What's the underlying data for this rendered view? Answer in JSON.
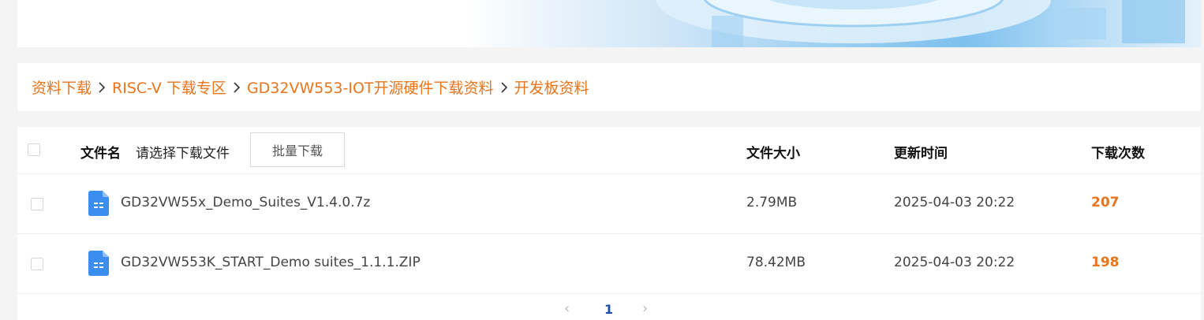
{
  "breadcrumb": {
    "items": [
      "资料下载",
      "RISC-V 下载专区",
      "GD32VW553-IOT开源硬件下载资料",
      "开发板资料"
    ]
  },
  "table": {
    "header": {
      "name": "文件名",
      "select_hint": "请选择下载文件",
      "batch_button": "批量下载",
      "size": "文件大小",
      "updated": "更新时间",
      "downloads": "下载次数"
    },
    "rows": [
      {
        "name": "GD32VW55x_Demo_Suites_V1.4.0.7z",
        "size": "2.79MB",
        "updated": "2025-04-03 20:22",
        "downloads": "207"
      },
      {
        "name": "GD32VW553K_START_Demo suites_1.1.1.ZIP",
        "size": "78.42MB",
        "updated": "2025-04-03 20:22",
        "downloads": "198"
      }
    ]
  },
  "pagination": {
    "prev": "‹",
    "current": "1",
    "next": "›"
  },
  "colors": {
    "accent": "#e8741b",
    "page_active": "#1e4fa8",
    "file_icon": "#3b8df0"
  }
}
